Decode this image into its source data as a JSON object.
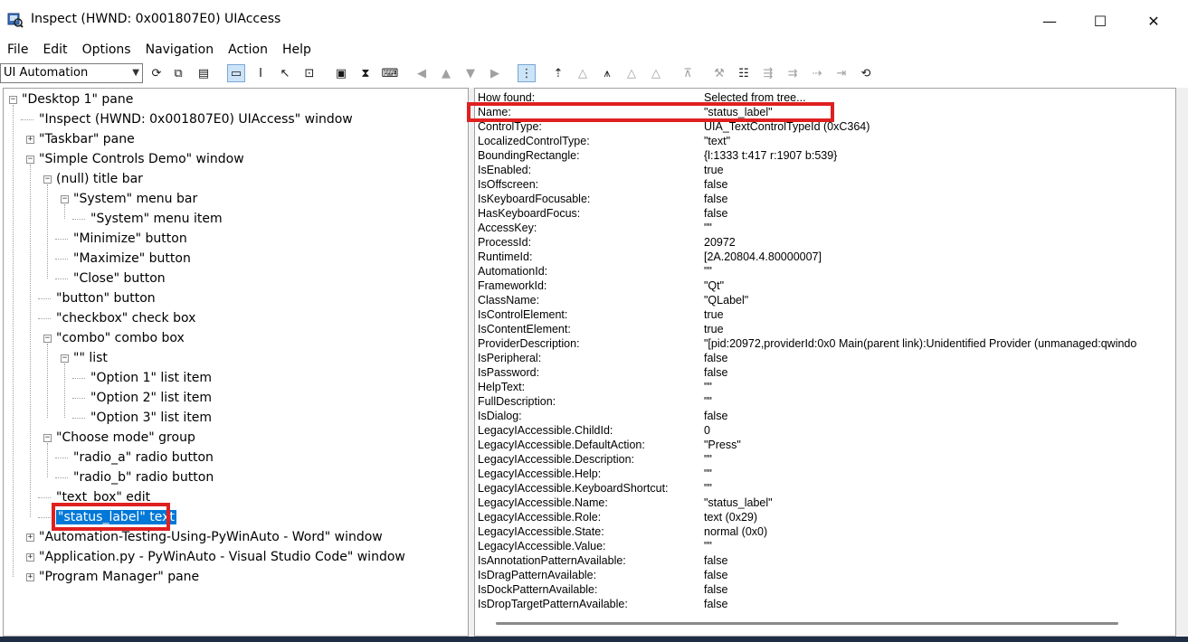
{
  "window": {
    "title": "Inspect  (HWND: 0x001807E0) UIAccess",
    "minimize": "—",
    "maximize": "☐",
    "close": "✕"
  },
  "menu": [
    "File",
    "Edit",
    "Options",
    "Navigation",
    "Action",
    "Help"
  ],
  "toolbar": {
    "mode_select": "UI Automation"
  },
  "tree": [
    {
      "label": "\"Desktop 1\" pane",
      "depth": 0,
      "expander": "minus"
    },
    {
      "label": "\"Inspect  (HWND: 0x001807E0) UIAccess\" window",
      "depth": 1,
      "expander": "none"
    },
    {
      "label": "\"Taskbar\" pane",
      "depth": 1,
      "expander": "plus"
    },
    {
      "label": "\"Simple Controls Demo\" window",
      "depth": 1,
      "expander": "minus"
    },
    {
      "label": "(null) title bar",
      "depth": 2,
      "expander": "minus"
    },
    {
      "label": "\"System\" menu bar",
      "depth": 3,
      "expander": "minus"
    },
    {
      "label": "\"System\" menu item",
      "depth": 4,
      "expander": "none"
    },
    {
      "label": "\"Minimize\" button",
      "depth": 3,
      "expander": "none"
    },
    {
      "label": "\"Maximize\" button",
      "depth": 3,
      "expander": "none"
    },
    {
      "label": "\"Close\" button",
      "depth": 3,
      "expander": "none"
    },
    {
      "label": "\"button\" button",
      "depth": 2,
      "expander": "none"
    },
    {
      "label": "\"checkbox\" check box",
      "depth": 2,
      "expander": "none"
    },
    {
      "label": "\"combo\" combo box",
      "depth": 2,
      "expander": "minus"
    },
    {
      "label": "\"\" list",
      "depth": 3,
      "expander": "minus"
    },
    {
      "label": "\"Option 1\" list item",
      "depth": 4,
      "expander": "none"
    },
    {
      "label": "\"Option 2\" list item",
      "depth": 4,
      "expander": "none"
    },
    {
      "label": "\"Option 3\" list item",
      "depth": 4,
      "expander": "none"
    },
    {
      "label": "\"Choose mode\" group",
      "depth": 2,
      "expander": "minus"
    },
    {
      "label": "\"radio_a\" radio button",
      "depth": 3,
      "expander": "none"
    },
    {
      "label": "\"radio_b\" radio button",
      "depth": 3,
      "expander": "none"
    },
    {
      "label": "\"text_box\" edit",
      "depth": 2,
      "expander": "none"
    },
    {
      "label": "\"status_label\" text",
      "depth": 2,
      "expander": "none",
      "selected": true
    },
    {
      "label": "\"Automation-Testing-Using-PyWinAuto - Word\" window",
      "depth": 1,
      "expander": "plus"
    },
    {
      "label": "\"Application.py - PyWinAuto - Visual Studio Code\" window",
      "depth": 1,
      "expander": "plus"
    },
    {
      "label": "\"Program Manager\" pane",
      "depth": 1,
      "expander": "plus"
    }
  ],
  "properties": [
    {
      "name": "How found:",
      "value": "Selected from tree..."
    },
    {
      "name": "Name:",
      "value": "\"status_label\""
    },
    {
      "name": "ControlType:",
      "value": "UIA_TextControlTypeId (0xC364)"
    },
    {
      "name": "LocalizedControlType:",
      "value": "\"text\""
    },
    {
      "name": "BoundingRectangle:",
      "value": "{l:1333 t:417 r:1907 b:539}"
    },
    {
      "name": "IsEnabled:",
      "value": "true"
    },
    {
      "name": "IsOffscreen:",
      "value": "false"
    },
    {
      "name": "IsKeyboardFocusable:",
      "value": "false"
    },
    {
      "name": "HasKeyboardFocus:",
      "value": "false"
    },
    {
      "name": "AccessKey:",
      "value": "\"\""
    },
    {
      "name": "ProcessId:",
      "value": "20972"
    },
    {
      "name": "RuntimeId:",
      "value": "[2A.20804.4.80000007]"
    },
    {
      "name": "AutomationId:",
      "value": "\"\""
    },
    {
      "name": "FrameworkId:",
      "value": "\"Qt\""
    },
    {
      "name": "ClassName:",
      "value": "\"QLabel\""
    },
    {
      "name": "IsControlElement:",
      "value": "true"
    },
    {
      "name": "IsContentElement:",
      "value": "true"
    },
    {
      "name": "ProviderDescription:",
      "value": "\"[pid:20972,providerId:0x0 Main(parent link):Unidentified Provider (unmanaged:qwindo"
    },
    {
      "name": "IsPeripheral:",
      "value": "false"
    },
    {
      "name": "IsPassword:",
      "value": "false"
    },
    {
      "name": "HelpText:",
      "value": "\"\""
    },
    {
      "name": "FullDescription:",
      "value": "\"\""
    },
    {
      "name": "IsDialog:",
      "value": "false"
    },
    {
      "name": "LegacyIAccessible.ChildId:",
      "value": "0"
    },
    {
      "name": "LegacyIAccessible.DefaultAction:",
      "value": "\"Press\""
    },
    {
      "name": "LegacyIAccessible.Description:",
      "value": "\"\""
    },
    {
      "name": "LegacyIAccessible.Help:",
      "value": "\"\""
    },
    {
      "name": "LegacyIAccessible.KeyboardShortcut:",
      "value": "\"\""
    },
    {
      "name": "LegacyIAccessible.Name:",
      "value": "\"status_label\""
    },
    {
      "name": "LegacyIAccessible.Role:",
      "value": "text (0x29)"
    },
    {
      "name": "LegacyIAccessible.State:",
      "value": "normal (0x0)"
    },
    {
      "name": "LegacyIAccessible.Value:",
      "value": "\"\""
    },
    {
      "name": "IsAnnotationPatternAvailable:",
      "value": "false"
    },
    {
      "name": "IsDragPatternAvailable:",
      "value": "false"
    },
    {
      "name": "IsDockPatternAvailable:",
      "value": "false"
    },
    {
      "name": "IsDropTargetPatternAvailable:",
      "value": "false"
    }
  ],
  "icons": {
    "app": "inspect-app-icon",
    "colors": {
      "selection": "#0078d7",
      "highlight_box": "#e02020"
    }
  }
}
